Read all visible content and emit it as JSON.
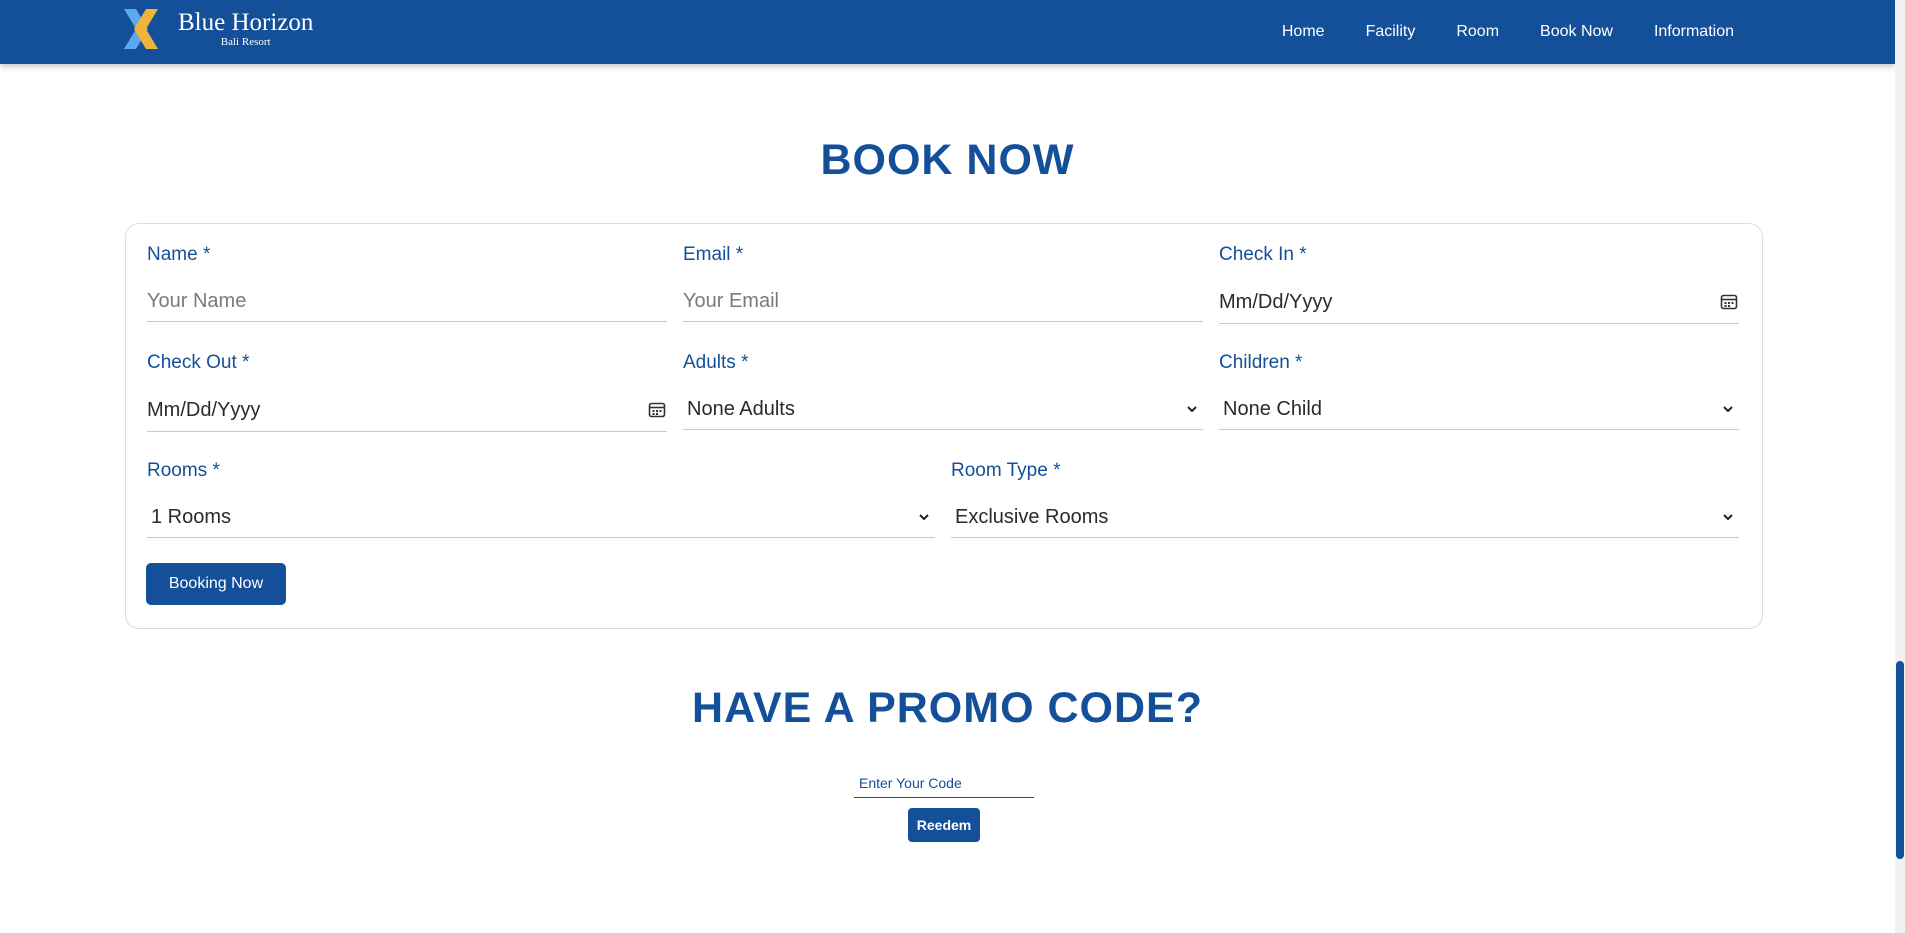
{
  "brand": {
    "name": "Blue Horizon",
    "subtitle": "Bali Resort",
    "logo_icon": "double-chevron-logo"
  },
  "nav": {
    "items": [
      {
        "label": "Home"
      },
      {
        "label": "Facility"
      },
      {
        "label": "Room"
      },
      {
        "label": "Book Now"
      },
      {
        "label": "Information"
      }
    ]
  },
  "booking": {
    "title": "BOOK NOW",
    "name": {
      "label": "Name *",
      "placeholder": "Your Name"
    },
    "email": {
      "label": "Email *",
      "placeholder": "Your Email"
    },
    "check_in": {
      "label": "Check In *",
      "value": "Mm/Dd/Yyyy",
      "icon": "calendar-icon"
    },
    "check_out": {
      "label": "Check Out *",
      "value": "Mm/Dd/Yyyy",
      "icon": "calendar-icon"
    },
    "adults": {
      "label": "Adults *",
      "value": "None Adults",
      "icon": "chevron-down-icon"
    },
    "children": {
      "label": "Children *",
      "value": "None Child",
      "icon": "chevron-down-icon"
    },
    "rooms": {
      "label": "Rooms *",
      "value": "1 Rooms",
      "icon": "chevron-down-icon"
    },
    "room_type": {
      "label": "Room Type *",
      "value": "Exclusive Rooms",
      "icon": "chevron-down-icon"
    },
    "submit_label": "Booking Now"
  },
  "promo": {
    "title": "HAVE A PROMO CODE?",
    "placeholder": "Enter Your Code",
    "button_label": "Reedem"
  },
  "colors": {
    "primary": "#144f9a",
    "logo_light": "#5aa8f0",
    "logo_gold": "#f0b43a"
  }
}
